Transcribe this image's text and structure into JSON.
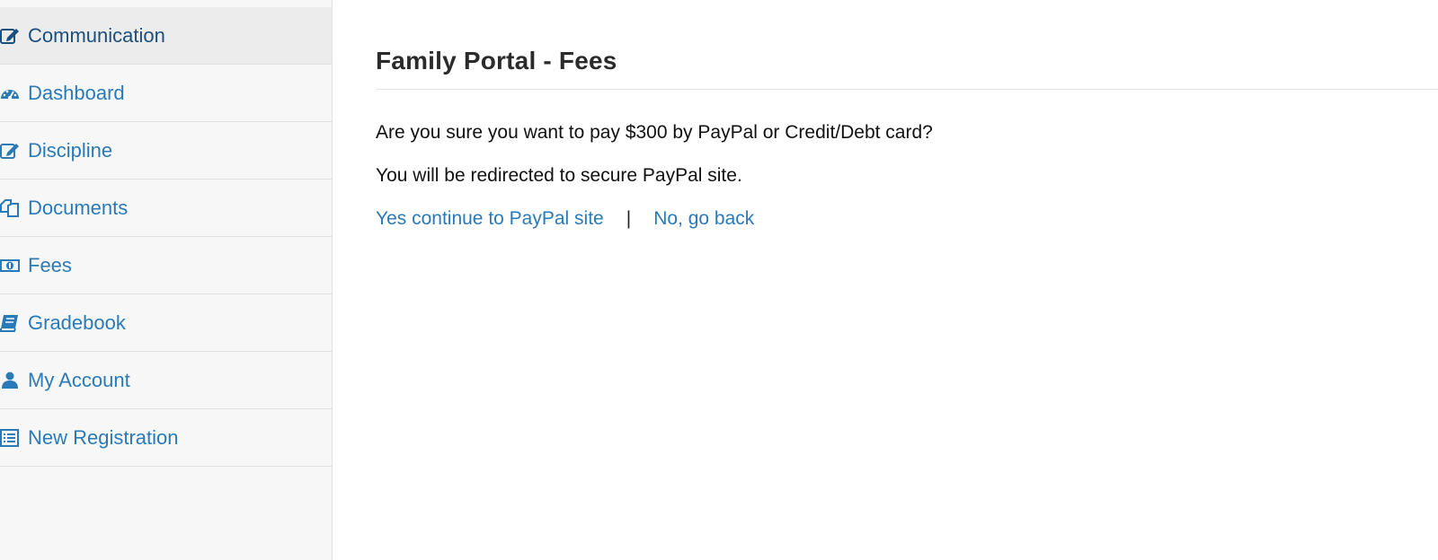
{
  "sidebar": {
    "items": [
      {
        "label": "Communication",
        "icon": "edit-icon",
        "active": true
      },
      {
        "label": "Dashboard",
        "icon": "dashboard-icon",
        "active": false
      },
      {
        "label": "Discipline",
        "icon": "edit-icon",
        "active": false
      },
      {
        "label": "Documents",
        "icon": "documents-icon",
        "active": false
      },
      {
        "label": "Fees",
        "icon": "money-icon",
        "active": false
      },
      {
        "label": "Gradebook",
        "icon": "book-icon",
        "active": false
      },
      {
        "label": "My Account",
        "icon": "user-icon",
        "active": false
      },
      {
        "label": "New Registration",
        "icon": "list-icon",
        "active": false
      }
    ]
  },
  "main": {
    "title": "Family Portal - Fees",
    "confirm_text": "Are you sure you want to pay $300 by PayPal or Credit/Debt card?",
    "redirect_text": "You will be redirected to secure PayPal site.",
    "yes_link": "Yes continue to PayPal site",
    "separator": "|",
    "no_link": "No, go back"
  },
  "colors": {
    "link": "#2a7ab8",
    "active_link": "#1d4f7c",
    "sidebar_bg": "#f7f7f7",
    "active_bg": "#ececec"
  }
}
